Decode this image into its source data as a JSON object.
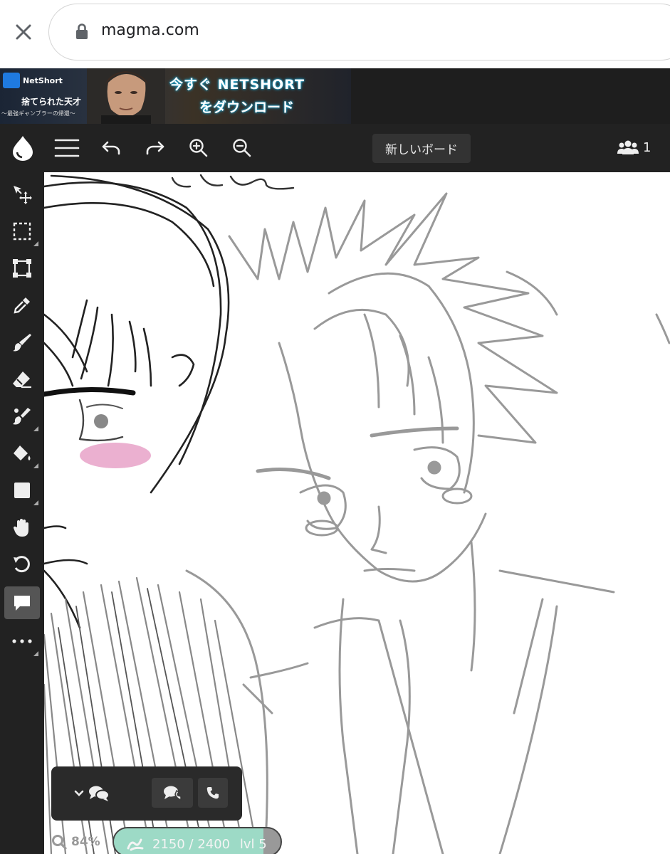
{
  "browser": {
    "url": "magma.com"
  },
  "ad": {
    "brand": "NetShort",
    "title_line1": "捨てられた天才",
    "title_line2": "〜最強ギャンブラーの帰還〜",
    "cta_line1": "今すぐ NETSHORT",
    "cta_line2": "をダウンロード"
  },
  "toolbar": {
    "new_board_label": "新しいボード",
    "user_count": "1",
    "icons": [
      "magma-logo-icon",
      "menu-icon",
      "undo-icon",
      "redo-icon",
      "zoom-in-icon",
      "zoom-out-icon",
      "users-icon"
    ]
  },
  "tools": [
    {
      "name": "move-icon"
    },
    {
      "name": "selection-icon"
    },
    {
      "name": "transform-icon"
    },
    {
      "name": "eyedropper-icon"
    },
    {
      "name": "brush-icon"
    },
    {
      "name": "eraser-icon"
    },
    {
      "name": "smudge-icon"
    },
    {
      "name": "paint-bucket-icon"
    },
    {
      "name": "shape-icon"
    },
    {
      "name": "hand-icon"
    },
    {
      "name": "rotate-icon"
    },
    {
      "name": "comment-icon",
      "active": true
    },
    {
      "name": "more-icon"
    }
  ],
  "chat": {
    "icons": [
      "chevron-down-icon",
      "chat-icon",
      "voice-chat-icon",
      "phone-icon"
    ]
  },
  "status": {
    "zoom": "84%",
    "progress_text": "2150 / 2400",
    "level": "lvl 5",
    "progress_fraction": 0.896
  },
  "colors": {
    "toolbar_bg": "#222222",
    "accent_progress": "#9ddac6",
    "blush": "#e8a2c8"
  }
}
